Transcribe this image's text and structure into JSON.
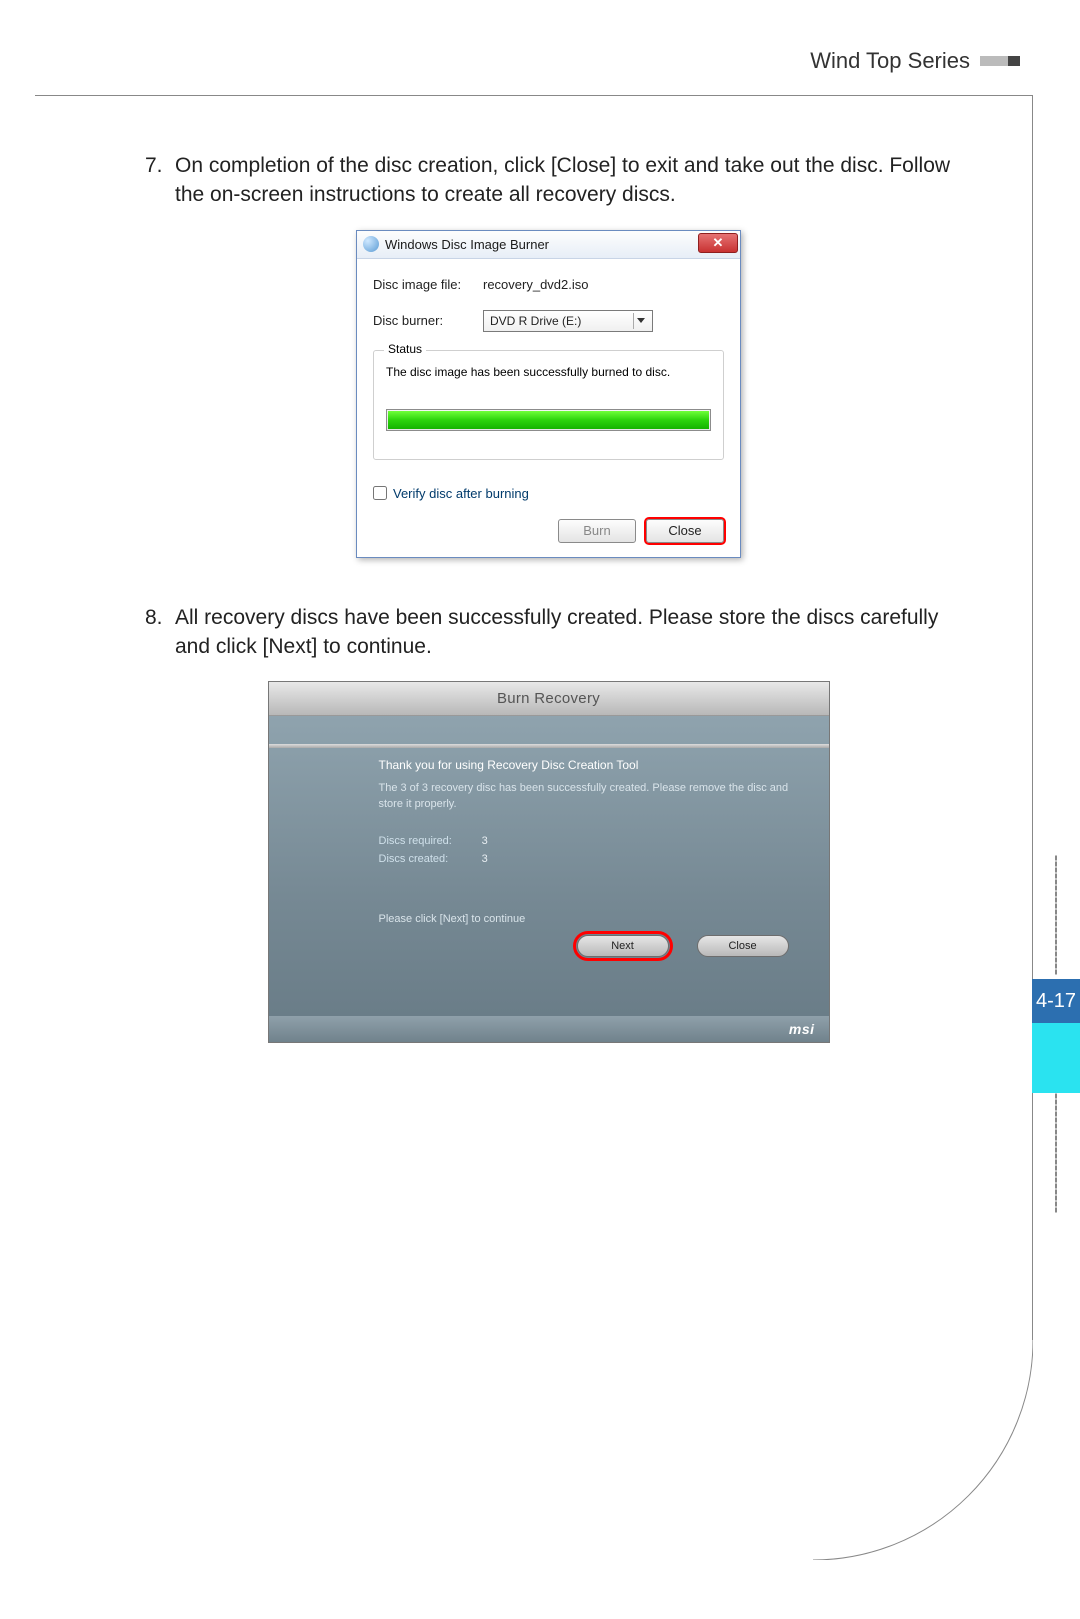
{
  "header": {
    "title": "Wind Top Series"
  },
  "page_tab": "4-17",
  "step7": {
    "num": "7.",
    "text": "On completion of the disc creation, click [Close] to exit and take out the disc. Follow the on-screen instructions to create all recovery discs."
  },
  "step8": {
    "num": "8.",
    "text": "All recovery discs have been successfully created. Please store the discs carefully and click [Next] to continue."
  },
  "win_dialog": {
    "title": "Windows Disc Image Burner",
    "close_glyph": "✕",
    "file_label": "Disc image file:",
    "file_value": "recovery_dvd2.iso",
    "burner_label": "Disc burner:",
    "burner_value": "DVD R Drive (E:)",
    "status_legend": "Status",
    "status_text": "The disc image has been successfully burned to disc.",
    "verify_label": "Verify disc after burning",
    "burn_btn": "Burn",
    "close_btn": "Close"
  },
  "msi_dialog": {
    "title": "Burn Recovery",
    "heading": "Thank you for using Recovery Disc Creation Tool",
    "message": "The 3 of 3 recovery disc has been successfully created. Please remove the disc and store it properly.",
    "discs_required_label": "Discs required:",
    "discs_required_value": "3",
    "discs_created_label": "Discs created:",
    "discs_created_value": "3",
    "hint": "Please click [Next] to continue",
    "next_btn": "Next",
    "close_btn": "Close",
    "brand": "msi"
  }
}
